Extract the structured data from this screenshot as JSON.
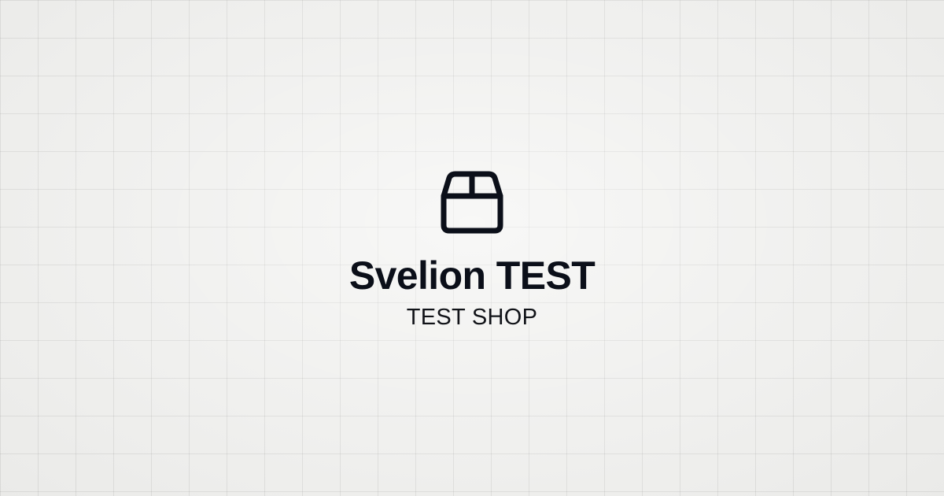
{
  "page": {
    "background_color": "#efefed",
    "grid_line_color": "#dcdcda"
  },
  "brand": {
    "icon": "package-box-icon",
    "icon_color": "#0b0f19",
    "name": "Svelion TEST",
    "name_color": "#0b0f19",
    "tagline": "TEST SHOP",
    "tagline_color": "#111318"
  }
}
